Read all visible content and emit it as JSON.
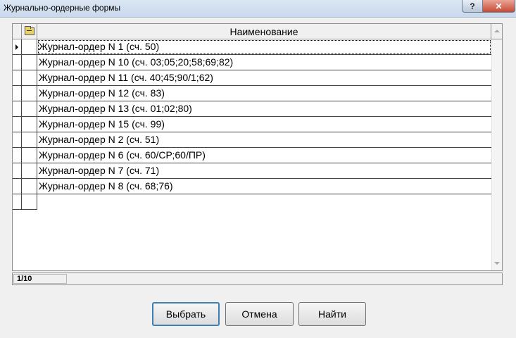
{
  "window": {
    "title": "Журнально-ордерные формы",
    "help_icon": "help-icon",
    "help_glyph": "?",
    "close_icon": "close-icon",
    "close_glyph": "✕"
  },
  "grid": {
    "column_header": "Наименование",
    "header_icon": "folder-up-icon",
    "selected_index": 0,
    "rows": [
      "Журнал-ордер N 1 (сч. 50)",
      "Журнал-ордер N 10 (сч. 03;05;20;58;69;82)",
      "Журнал-ордер N 11 (сч. 40;45;90/1;62)",
      "Журнал-ордер N 12 (сч. 83)",
      "Журнал-ордер N 13 (сч. 01;02;80)",
      "Журнал-ордер N 15 (сч. 99)",
      "Журнал-ордер N 2 (сч. 51)",
      "Журнал-ордер N 6 (сч. 60/СР;60/ПР)",
      "Журнал-ордер N 7 (сч. 71)",
      "Журнал-ордер N 8 (сч. 68;76)"
    ]
  },
  "status": {
    "record_counter": "1/10"
  },
  "buttons": {
    "select": "Выбрать",
    "cancel": "Отмена",
    "find": "Найти"
  },
  "colors": {
    "close_button": "#c74a33",
    "default_button_border": "#3c7fb1"
  }
}
